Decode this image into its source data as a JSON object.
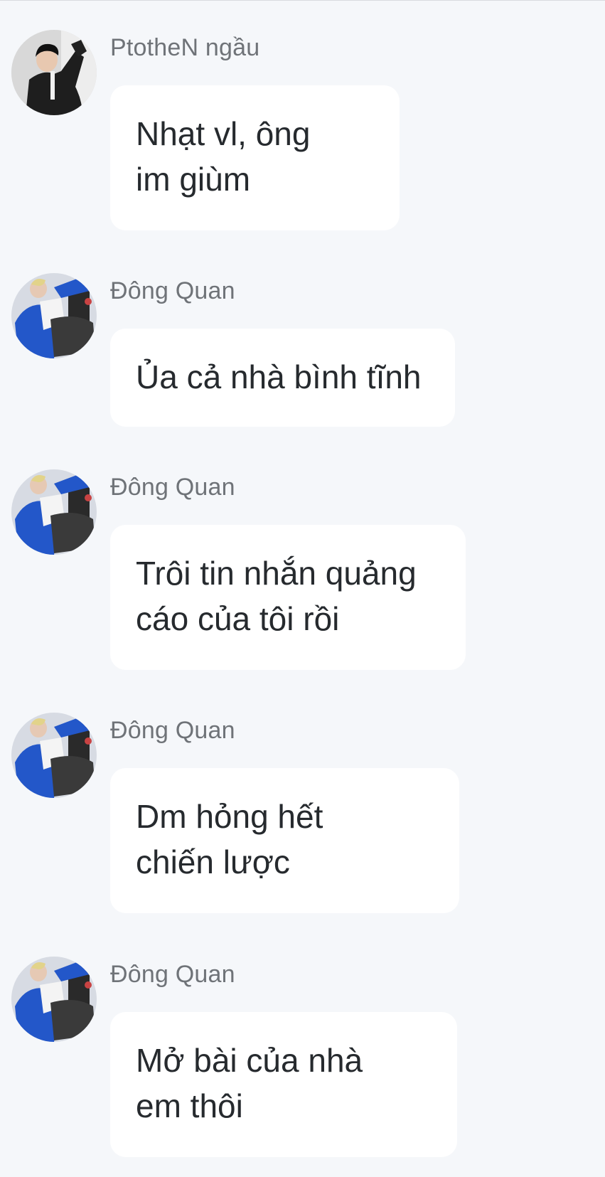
{
  "messages": [
    {
      "sender": "PtotheN ngầu",
      "avatar_icon": "user-avatar-ptothen",
      "lines": [
        "Nhạt vl, ông",
        "im giùm"
      ]
    },
    {
      "sender": "Đông Quan",
      "avatar_icon": "user-avatar-dong-quan",
      "lines": [
        "Ủa cả nhà bình tĩnh"
      ]
    },
    {
      "sender": "Đông Quan",
      "avatar_icon": "user-avatar-dong-quan",
      "lines": [
        "Trôi tin nhắn quảng",
        "cáo của tôi rồi"
      ]
    },
    {
      "sender": "Đông Quan",
      "avatar_icon": "user-avatar-dong-quan",
      "lines": [
        "Dm hỏng hết",
        "chiến lược"
      ]
    },
    {
      "sender": "Đông Quan",
      "avatar_icon": "user-avatar-dong-quan",
      "lines": [
        "Mở bài của nhà",
        "em thôi"
      ]
    }
  ],
  "colors": {
    "background": "#f5f7fa",
    "bubble": "#ffffff",
    "sender_text": "#6f7378",
    "message_text": "#262a2e",
    "accent_blue": "#2357c9"
  }
}
